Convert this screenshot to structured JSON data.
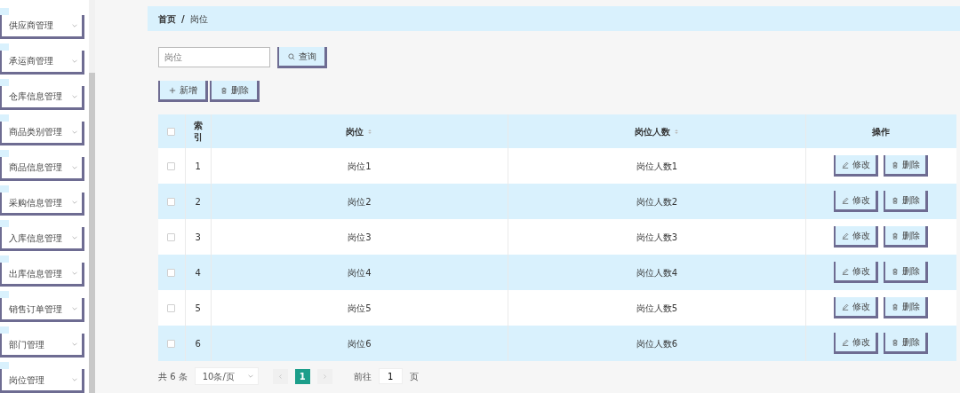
{
  "sidebar": {
    "items": [
      {
        "label": "供应商管理",
        "expanded": false
      },
      {
        "label": "承运商管理",
        "expanded": false
      },
      {
        "label": "仓库信息管理",
        "expanded": false
      },
      {
        "label": "商品类别管理",
        "expanded": false
      },
      {
        "label": "商品信息管理",
        "expanded": false
      },
      {
        "label": "采购信息管理",
        "expanded": false
      },
      {
        "label": "入库信息管理",
        "expanded": false
      },
      {
        "label": "出库信息管理",
        "expanded": false
      },
      {
        "label": "销售订单管理",
        "expanded": false
      },
      {
        "label": "部门管理",
        "expanded": false
      },
      {
        "label": "岗位管理",
        "expanded": false
      }
    ]
  },
  "breadcrumb": {
    "items": [
      "首页",
      "岗位"
    ],
    "separator": "/"
  },
  "search": {
    "placeholder": "岗位",
    "button": "查询"
  },
  "toolbar": [
    {
      "kind": "add",
      "label": "新增"
    },
    {
      "kind": "delete",
      "label": "删除"
    }
  ],
  "table": {
    "select_all_checked": false,
    "columns": [
      {
        "label": "索引",
        "sortable": false
      },
      {
        "label": "岗位",
        "sortable": true
      },
      {
        "label": "岗位人数",
        "sortable": true
      },
      {
        "label": "操作",
        "sortable": false
      }
    ],
    "rows": [
      {
        "checked": false,
        "index": "1",
        "post": "岗位1",
        "count": "岗位人数1",
        "actions": [
          {
            "kind": "edit",
            "label": "修改"
          },
          {
            "kind": "delete",
            "label": "删除"
          }
        ]
      },
      {
        "checked": false,
        "index": "2",
        "post": "岗位2",
        "count": "岗位人数2",
        "actions": [
          {
            "kind": "edit",
            "label": "修改"
          },
          {
            "kind": "delete",
            "label": "删除"
          }
        ]
      },
      {
        "checked": false,
        "index": "3",
        "post": "岗位3",
        "count": "岗位人数3",
        "actions": [
          {
            "kind": "edit",
            "label": "修改"
          },
          {
            "kind": "delete",
            "label": "删除"
          }
        ]
      },
      {
        "checked": false,
        "index": "4",
        "post": "岗位4",
        "count": "岗位人数4",
        "actions": [
          {
            "kind": "edit",
            "label": "修改"
          },
          {
            "kind": "delete",
            "label": "删除"
          }
        ]
      },
      {
        "checked": false,
        "index": "5",
        "post": "岗位5",
        "count": "岗位人数5",
        "actions": [
          {
            "kind": "edit",
            "label": "修改"
          },
          {
            "kind": "delete",
            "label": "删除"
          }
        ]
      },
      {
        "checked": false,
        "index": "6",
        "post": "岗位6",
        "count": "岗位人数6",
        "actions": [
          {
            "kind": "edit",
            "label": "修改"
          },
          {
            "kind": "delete",
            "label": "删除"
          }
        ]
      }
    ]
  },
  "pagination": {
    "total": "共 6 条",
    "page_size": "10条/页",
    "pages": [
      {
        "label": "1",
        "selected": true
      }
    ],
    "goto_label": "前往",
    "goto_value": "1",
    "goto_suffix": "页"
  }
}
